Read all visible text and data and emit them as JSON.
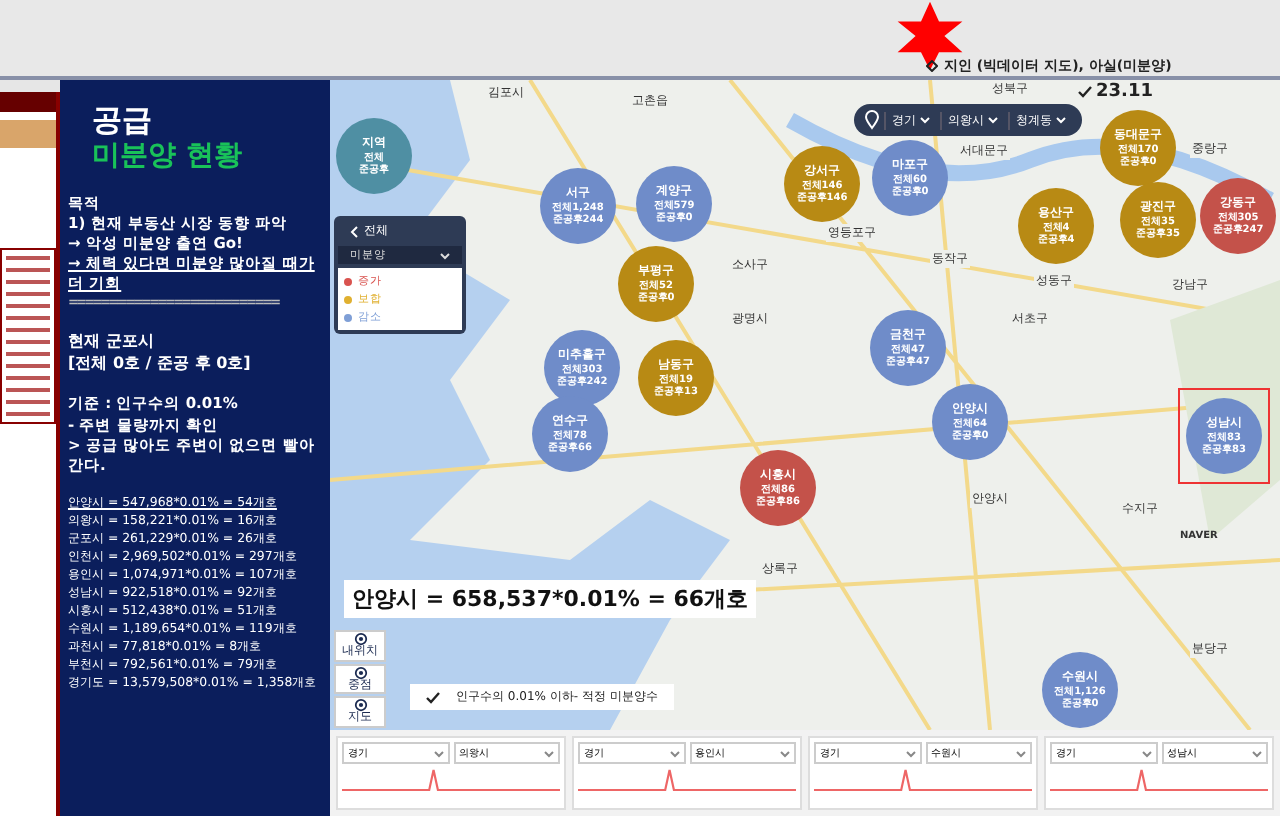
{
  "header": {
    "note": "지인 (빅데이터 지도), 아실(미분양)"
  },
  "panel": {
    "title": "공급",
    "subtitle": "미분양 현황",
    "purpose": [
      {
        "text": "목적",
        "underline": false
      },
      {
        "text": "1) 현재 부동산 시장 동향 파악",
        "underline": false
      },
      {
        "text": "→ 악성 미분양 출연 Go!",
        "underline": false
      },
      {
        "text": "→ 체력 있다면 미분양 많아질 때가 더 기회",
        "underline": true
      }
    ],
    "divider": "==========================",
    "current": [
      "현재 군포시",
      "[전체 0호 / 준공 후 0호]"
    ],
    "criteria": [
      "기준 : 인구수의 0.01%",
      "- 주변 물량까지 확인",
      "> 공급 많아도 주변이 없으면 빨아간다."
    ],
    "calcs": [
      {
        "text": "안양시 = 547,968*0.01% = 54개호",
        "underline": true
      },
      {
        "text": "의왕시 = 158,221*0.01% = 16개호",
        "underline": false
      },
      {
        "text": "군포시 = 261,229*0.01% = 26개호",
        "underline": false
      },
      {
        "text": "인천시 = 2,969,502*0.01% = 297개호",
        "underline": false
      },
      {
        "text": "용인시 = 1,074,971*0.01% = 107개호",
        "underline": false
      },
      {
        "text": "성남시 = 922,518*0.01% = 92개호",
        "underline": false
      },
      {
        "text": "시흥시 = 512,438*0.01% = 51개호",
        "underline": false
      },
      {
        "text": "수원시 = 1,189,654*0.01% = 119개호",
        "underline": false
      },
      {
        "text": "과천시 = 77,818*0.01% =  8개호",
        "underline": false
      },
      {
        "text": "부천시 = 792,561*0.01% = 79개호",
        "underline": false
      },
      {
        "text": "경기도 = 13,579,508*0.01% = 1,358개호",
        "underline": false
      }
    ]
  },
  "map": {
    "filters": [
      "경기",
      "의왕시",
      "청계동"
    ],
    "date": "23.11",
    "back_label": "전체",
    "mode": "미분양",
    "legend": [
      {
        "label": "증가",
        "color": "#d9534f"
      },
      {
        "label": "보합",
        "color": "#e0b030"
      },
      {
        "label": "감소",
        "color": "#7f9fd6"
      }
    ],
    "places": [
      "김포시",
      "고촌읍",
      "서대문구",
      "성북구",
      "중랑구",
      "성동구",
      "영등포구",
      "동작구",
      "광명시",
      "소사구",
      "서초구",
      "강남구",
      "안양시",
      "상록구",
      "수지구",
      "분당구"
    ],
    "bubbles": [
      {
        "name": "지역",
        "total": "전체",
        "completed": "준공후",
        "color": "#4f8fa3",
        "highlighted": false
      },
      {
        "name": "서구",
        "total": "전체1,248",
        "completed": "준공후244",
        "color": "#6f8cc9",
        "highlighted": false
      },
      {
        "name": "계양구",
        "total": "전체579",
        "completed": "준공후0",
        "color": "#6f8cc9",
        "highlighted": false
      },
      {
        "name": "강서구",
        "total": "전체146",
        "completed": "준공후146",
        "color": "#b88a14",
        "highlighted": false
      },
      {
        "name": "마포구",
        "total": "전체60",
        "completed": "준공후0",
        "color": "#6f8cc9",
        "highlighted": false
      },
      {
        "name": "용산구",
        "total": "전체4",
        "completed": "준공후4",
        "color": "#b88a14",
        "highlighted": false
      },
      {
        "name": "동대문구",
        "total": "전체170",
        "completed": "준공후0",
        "color": "#b88a14",
        "highlighted": false
      },
      {
        "name": "광진구",
        "total": "전체35",
        "completed": "준공후35",
        "color": "#b88a14",
        "highlighted": false
      },
      {
        "name": "강동구",
        "total": "전체305",
        "completed": "준공후247",
        "color": "#c4524a",
        "highlighted": false
      },
      {
        "name": "부평구",
        "total": "전체52",
        "completed": "준공후0",
        "color": "#b88a14",
        "highlighted": false
      },
      {
        "name": "금천구",
        "total": "전체47",
        "completed": "준공후47",
        "color": "#6f8cc9",
        "highlighted": false
      },
      {
        "name": "미추홀구",
        "total": "전체303",
        "completed": "준공후242",
        "color": "#6f8cc9",
        "highlighted": false
      },
      {
        "name": "남동구",
        "total": "전체19",
        "completed": "준공후13",
        "color": "#b88a14",
        "highlighted": false
      },
      {
        "name": "연수구",
        "total": "전체78",
        "completed": "준공후66",
        "color": "#6f8cc9",
        "highlighted": false
      },
      {
        "name": "안양시",
        "total": "전체64",
        "completed": "준공후0",
        "color": "#6f8cc9",
        "highlighted": false
      },
      {
        "name": "성남시",
        "total": "전체83",
        "completed": "준공후83",
        "color": "#6f8cc9",
        "highlighted": true
      },
      {
        "name": "시흥시",
        "total": "전체86",
        "completed": "준공후86",
        "color": "#c4524a",
        "highlighted": false
      },
      {
        "name": "수원시",
        "total": "전체1,126",
        "completed": "준공후0",
        "color": "#6f8cc9",
        "highlighted": false
      }
    ],
    "callout": "안양시 = 658,537*0.01% = 66개호",
    "check_note": "인구수의 0.01% 이하- 적정 미분양수",
    "tools": [
      "내위치",
      "중점",
      "지도"
    ],
    "brand": "NAVER"
  },
  "bottom": {
    "selects": [
      "경기",
      "의왕시",
      "경기",
      "용인시",
      "경기",
      "수원시",
      "경기",
      "성남시"
    ]
  }
}
